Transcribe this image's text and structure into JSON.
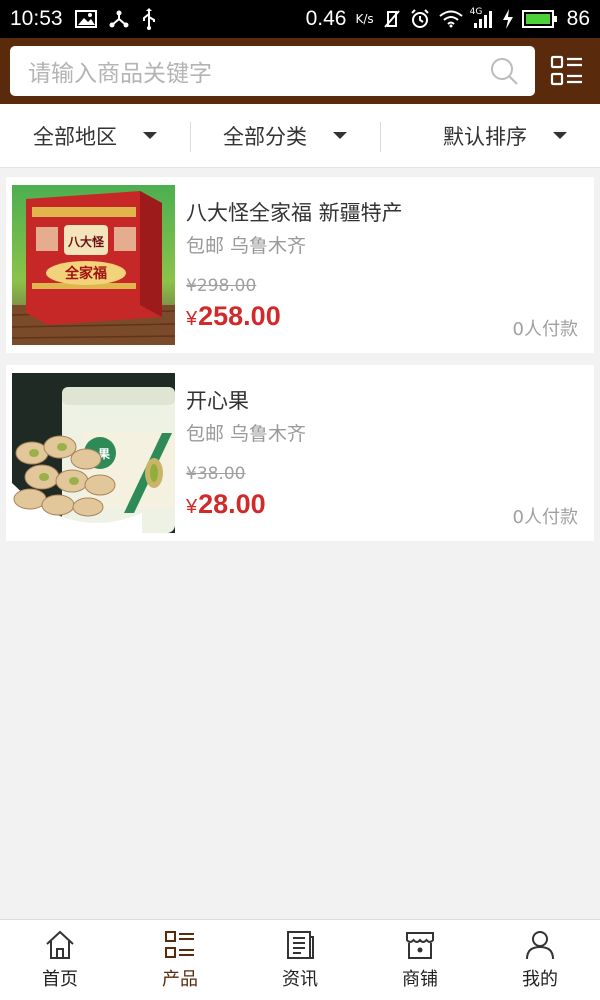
{
  "status_bar": {
    "time": "10:53",
    "speed": "0.46",
    "speed_unit": "K/s",
    "network": "4G",
    "battery": "86"
  },
  "search": {
    "placeholder": "请输入商品关键字"
  },
  "filters": [
    {
      "label": "全部地区"
    },
    {
      "label": "全部分类"
    },
    {
      "label": "默认排序"
    }
  ],
  "products": [
    {
      "name": "八大怪全家福 新疆特产",
      "shipping": "包邮 乌鲁木齐",
      "old_price": "¥298.00",
      "currency": "¥",
      "price": "258.00",
      "sold": "0人付款",
      "image_text": [
        "八大怪",
        "全家福"
      ]
    },
    {
      "name": "开心果",
      "shipping": "包邮 乌鲁木齐",
      "old_price": "¥38.00",
      "currency": "¥",
      "price": "28.00",
      "sold": "0人付款",
      "image_text": [
        "果"
      ]
    }
  ],
  "tabs": [
    {
      "label": "首页",
      "icon": "home-icon"
    },
    {
      "label": "产品",
      "icon": "list-icon",
      "active": true
    },
    {
      "label": "资讯",
      "icon": "news-icon"
    },
    {
      "label": "商铺",
      "icon": "shop-icon"
    },
    {
      "label": "我的",
      "icon": "user-icon"
    }
  ],
  "colors": {
    "header_bg": "#5a2a0c",
    "price_red": "#d12a2a",
    "active_tab": "#5a2a0c"
  }
}
